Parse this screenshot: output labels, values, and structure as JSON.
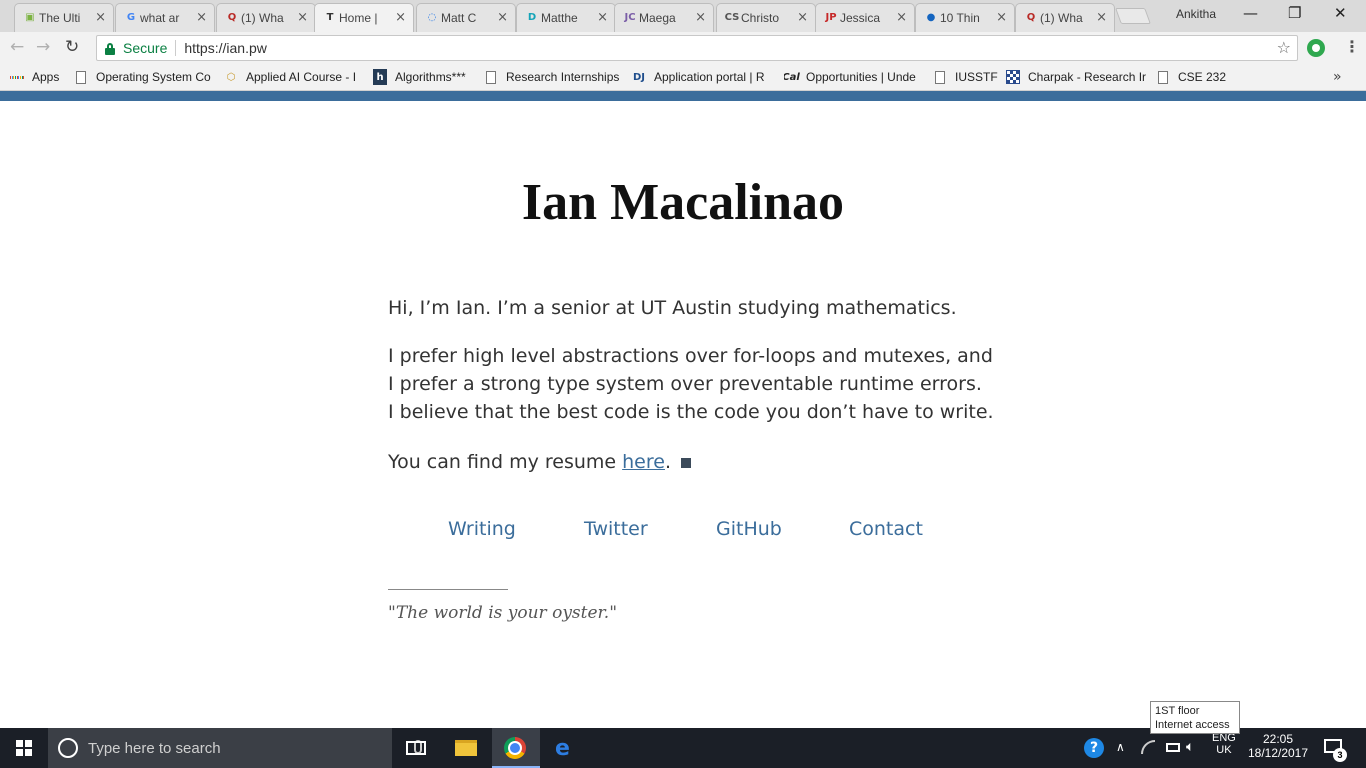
{
  "browser": {
    "tabs": [
      {
        "title": "The Ulti",
        "icon": "green-doc-icon",
        "color": "#7cb342",
        "glyph": "▣"
      },
      {
        "title": "what ar",
        "icon": "google-icon",
        "color": "#4285f4",
        "glyph": "G"
      },
      {
        "title": "(1) Wha",
        "icon": "quora-icon",
        "color": "#b92b27",
        "glyph": "Q"
      },
      {
        "title": "Home |",
        "icon": "t-icon",
        "color": "#333333",
        "glyph": "T"
      },
      {
        "title": "Matt C",
        "icon": "spinner-icon",
        "color": "#1a73e8",
        "glyph": "◌"
      },
      {
        "title": "Matthe",
        "icon": "d-icon",
        "color": "#14a4b8",
        "glyph": "D"
      },
      {
        "title": "Maega",
        "icon": "jc-icon",
        "color": "#7b5ea7",
        "glyph": "JC"
      },
      {
        "title": "Christo",
        "icon": "cs-icon",
        "color": "#555555",
        "glyph": "CS"
      },
      {
        "title": "Jessica",
        "icon": "jp-icon",
        "color": "#c62828",
        "glyph": "JP"
      },
      {
        "title": "10 Thin",
        "icon": "globe-icon",
        "color": "#1565c0",
        "glyph": "●"
      },
      {
        "title": "(1) Wha",
        "icon": "quora-icon",
        "color": "#b92b27",
        "glyph": "Q"
      }
    ],
    "profile_name": "Ankitha",
    "secure_label": "Secure",
    "url": "https://ian.pw",
    "bookmarks": [
      {
        "label": "Apps",
        "icon": "apps-grid-icon"
      },
      {
        "label": "Operating System Co",
        "icon": "page-icon"
      },
      {
        "label": "Applied AI Course - I",
        "icon": "hexagon-icon"
      },
      {
        "label": "Algorithms***",
        "icon": "h-icon"
      },
      {
        "label": "Research Internships",
        "icon": "page-icon"
      },
      {
        "label": "Application portal | R",
        "icon": "dj-icon"
      },
      {
        "label": "Opportunities | Unde",
        "icon": "cal-icon"
      },
      {
        "label": "IUSSTF",
        "icon": "page-icon"
      },
      {
        "label": "Charpak - Research Ir",
        "icon": "checker-icon"
      },
      {
        "label": "CSE 232",
        "icon": "page-icon"
      }
    ]
  },
  "page": {
    "name": "Ian Macalinao",
    "intro": "Hi, I’m Ian. I’m a senior at UT Austin studying mathematics.",
    "prefs": [
      "I prefer high level abstractions over for-loops and mutexes, and",
      "I prefer a strong type system over preventable runtime errors.",
      "I believe that the best code is the code you don’t have to write."
    ],
    "resume_prefix": "You can find my resume ",
    "resume_link": "here",
    "resume_suffix": ".",
    "nav": [
      "Writing",
      "Twitter",
      "GitHub",
      "Contact"
    ],
    "quote": "\"The world is your oyster.\"",
    "accent_color": "#3b6d9b"
  },
  "tooltip": {
    "line1": "1ST floor",
    "line2": "Internet access"
  },
  "taskbar": {
    "search_placeholder": "Type here to search",
    "lang_top": "ENG",
    "lang_bottom": "UK",
    "time": "22:05",
    "date": "18/12/2017",
    "notification_count": "3"
  }
}
